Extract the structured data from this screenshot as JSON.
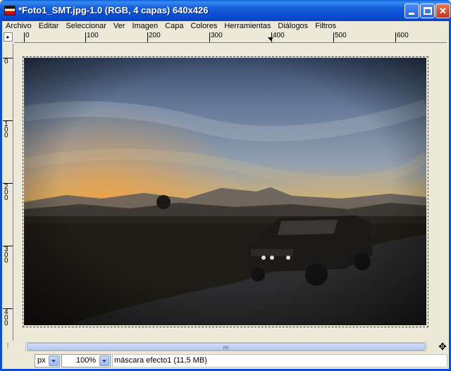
{
  "window": {
    "title": "*Foto1_SMT.jpg-1.0 (RGB, 4 capas) 640x426"
  },
  "menubar": {
    "items": [
      "Archivo",
      "Editar",
      "Seleccionar",
      "Ver",
      "Imagen",
      "Capa",
      "Colores",
      "Herramientas",
      "Diálogos",
      "Filtros"
    ]
  },
  "ruler": {
    "h_labels": [
      "0",
      "100",
      "200",
      "300",
      "400",
      "500",
      "600"
    ],
    "v_labels": [
      "0",
      "100",
      "200",
      "300",
      "400"
    ]
  },
  "canvas": {
    "image_description_icon": "photo-icon"
  },
  "statusbar": {
    "unit": "px",
    "zoom": "100%",
    "layer_info": "máscara efecto1 (11,5 MB)"
  },
  "icons": {
    "title": "gimp-window-icon",
    "minimize": "minimize-icon",
    "maximize": "maximize-icon",
    "close": "close-icon",
    "ruler_corner": "quick-mask-icon",
    "nav": "navigate-icon"
  }
}
